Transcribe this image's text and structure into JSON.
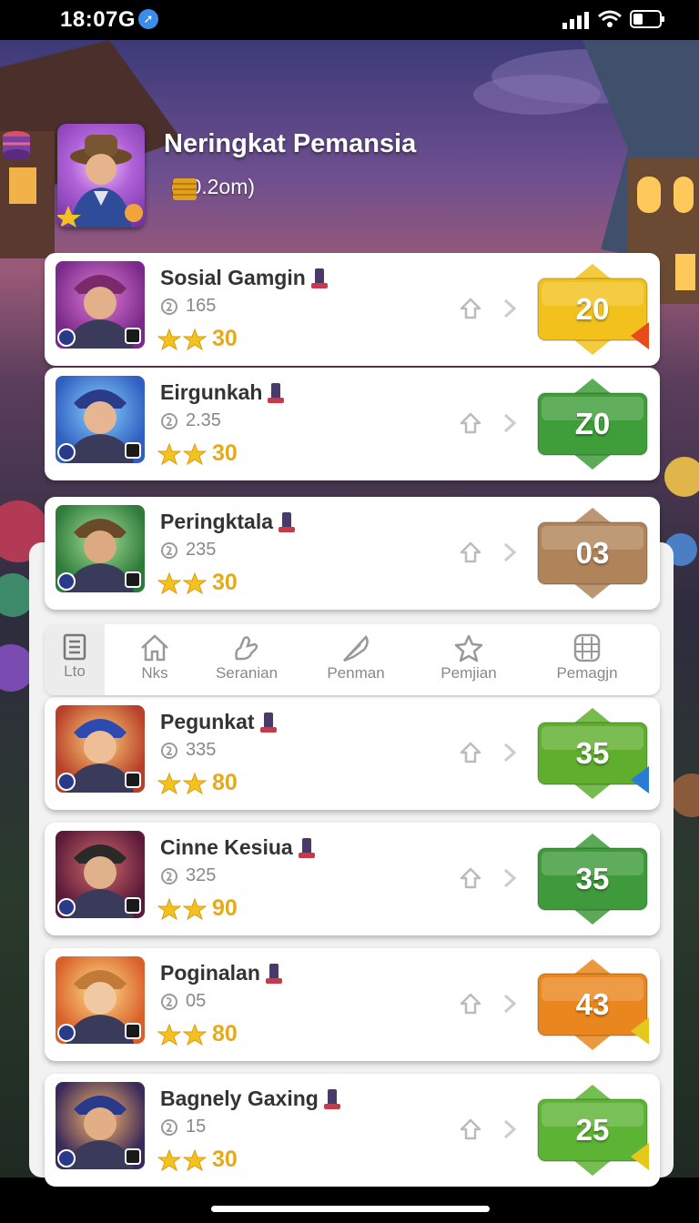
{
  "status": {
    "time": "18:07G"
  },
  "header": {
    "title": "Neringkat Pemansia",
    "meta": "(90.2om)"
  },
  "players": [
    {
      "name": "Sosial Gamgin",
      "sub": "165",
      "stars": "30",
      "rank": "20",
      "color": "#f2c11c"
    },
    {
      "name": "Eirgunkah",
      "sub": "2.35",
      "stars": "30",
      "rank": "Z0",
      "color": "#3f9e3a"
    },
    {
      "name": "Peringktala",
      "sub": "235",
      "stars": "30",
      "rank": "03",
      "color": "#b0845a"
    },
    {
      "name": "Pegunkat",
      "sub": "335",
      "stars": "80",
      "rank": "35",
      "color": "#5fae2e"
    },
    {
      "name": "Cinne Kesiua",
      "sub": "325",
      "stars": "90",
      "rank": "35",
      "color": "#3e9a3a"
    },
    {
      "name": "Poginalan",
      "sub": "05",
      "stars": "80",
      "rank": "43",
      "color": "#e9861d"
    },
    {
      "name": "Bagnely Gaxing",
      "sub": "15",
      "stars": "30",
      "rank": "25",
      "color": "#5db334"
    }
  ],
  "tabs": [
    {
      "label": "Lto",
      "icon": "list-icon"
    },
    {
      "label": "Nks",
      "icon": "home-icon"
    },
    {
      "label": "Seranian",
      "icon": "hand-icon"
    },
    {
      "label": "Penman",
      "icon": "feather-icon"
    },
    {
      "label": "Pemjian",
      "icon": "star-icon"
    },
    {
      "label": "Pemagjn",
      "icon": "grid-icon"
    }
  ]
}
